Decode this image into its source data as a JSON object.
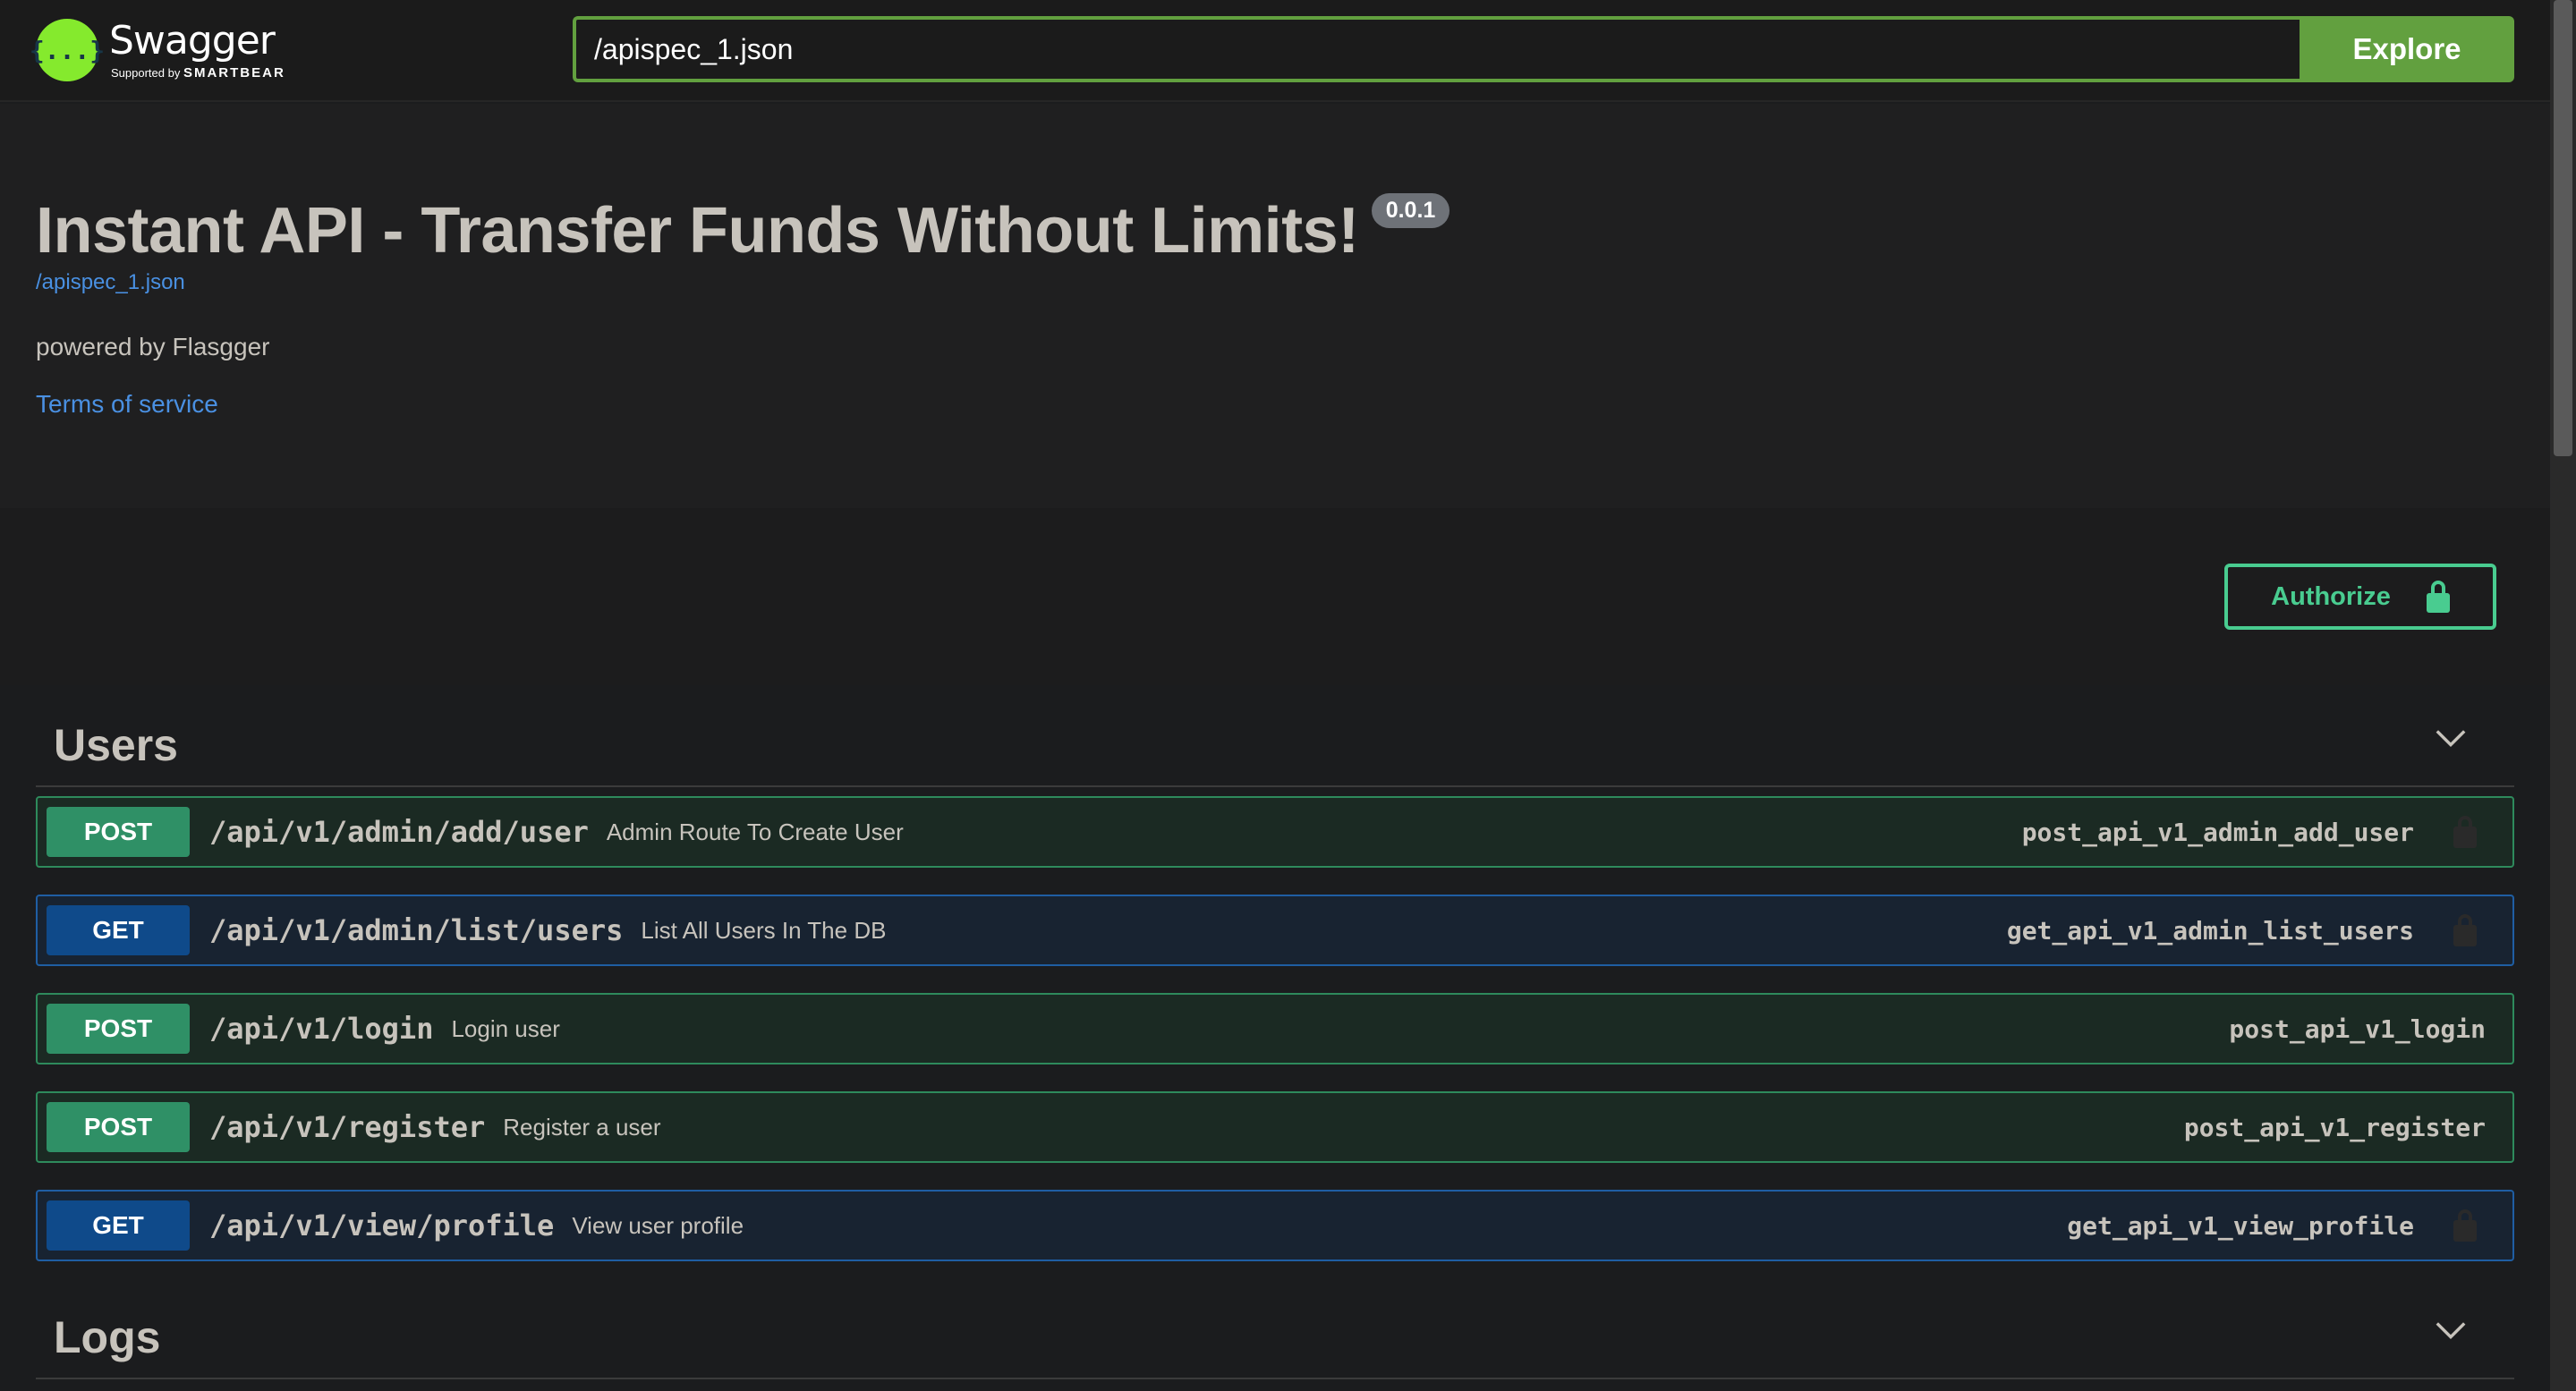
{
  "topbar": {
    "logo_icon": "{...}",
    "logo_name": "Swagger",
    "logo_sub_prefix": "Supported by",
    "logo_sub_brand": "SMARTBEAR",
    "url_value": "/apispec_1.json",
    "explore_label": "Explore"
  },
  "info": {
    "title": "Instant API - Transfer Funds Without Limits!",
    "version": "0.0.1",
    "spec_link": "/apispec_1.json",
    "powered": "powered by Flasgger",
    "terms": "Terms of service"
  },
  "scheme": {
    "authorize_label": "Authorize"
  },
  "tags": [
    {
      "name": "Users",
      "operations": [
        {
          "method": "POST",
          "path": "/api/v1/admin/add/user",
          "summary": "Admin Route To Create User",
          "operation_id": "post_api_v1_admin_add_user",
          "locked": true
        },
        {
          "method": "GET",
          "path": "/api/v1/admin/list/users",
          "summary": "List All Users In The DB",
          "operation_id": "get_api_v1_admin_list_users",
          "locked": true
        },
        {
          "method": "POST",
          "path": "/api/v1/login",
          "summary": "Login user",
          "operation_id": "post_api_v1_login",
          "locked": false
        },
        {
          "method": "POST",
          "path": "/api/v1/register",
          "summary": "Register a user",
          "operation_id": "post_api_v1_register",
          "locked": false
        },
        {
          "method": "GET",
          "path": "/api/v1/view/profile",
          "summary": "View user profile",
          "operation_id": "get_api_v1_view_profile",
          "locked": true
        }
      ]
    },
    {
      "name": "Logs",
      "operations": []
    }
  ],
  "colors": {
    "accent_green": "#62a03f",
    "post": "#49cc90",
    "get": "#61affe"
  }
}
